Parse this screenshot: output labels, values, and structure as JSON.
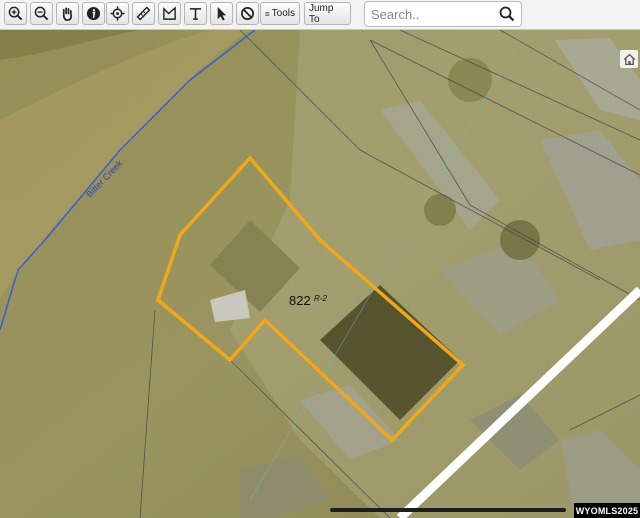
{
  "toolbar": {
    "buttons": [
      {
        "name": "zoom-in-icon"
      },
      {
        "name": "zoom-out-icon"
      },
      {
        "name": "pan-hand-icon"
      },
      {
        "name": "info-icon"
      },
      {
        "name": "locate-icon"
      },
      {
        "name": "measure-ruler-icon"
      },
      {
        "name": "measure-area-icon"
      },
      {
        "name": "text-tool-icon"
      },
      {
        "name": "select-pointer-icon"
      },
      {
        "name": "clear-icon"
      }
    ],
    "tools_label": "Tools",
    "jump_to_label": "Jump To"
  },
  "search": {
    "placeholder": "Search.."
  },
  "map": {
    "parcel_label": "822",
    "parcel_sublabel": "R-2",
    "creek_label": "Bitter Creek",
    "parcel_color": "#f0a818",
    "creek_color": "#3a5fd0",
    "road_color": "#ffffff"
  },
  "watermark": "WYOMLS2025"
}
